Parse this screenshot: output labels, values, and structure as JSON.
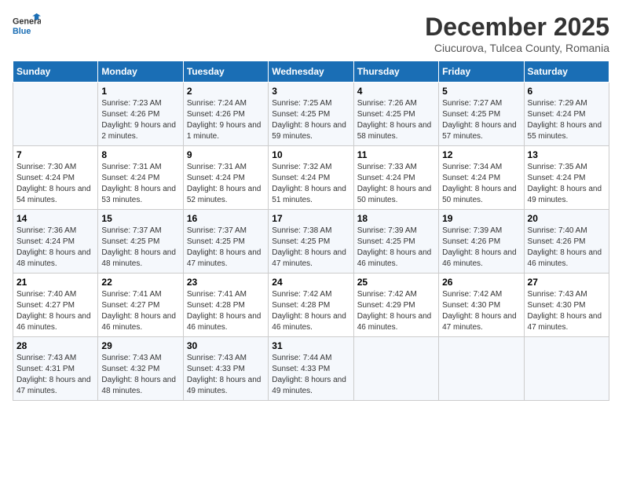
{
  "logo": {
    "line1": "General",
    "line2": "Blue"
  },
  "title": "December 2025",
  "subtitle": "Ciucurova, Tulcea County, Romania",
  "weekdays": [
    "Sunday",
    "Monday",
    "Tuesday",
    "Wednesday",
    "Thursday",
    "Friday",
    "Saturday"
  ],
  "weeks": [
    [
      {
        "day": "",
        "sunrise": "",
        "sunset": "",
        "daylight": ""
      },
      {
        "day": "1",
        "sunrise": "Sunrise: 7:23 AM",
        "sunset": "Sunset: 4:26 PM",
        "daylight": "Daylight: 9 hours and 2 minutes."
      },
      {
        "day": "2",
        "sunrise": "Sunrise: 7:24 AM",
        "sunset": "Sunset: 4:26 PM",
        "daylight": "Daylight: 9 hours and 1 minute."
      },
      {
        "day": "3",
        "sunrise": "Sunrise: 7:25 AM",
        "sunset": "Sunset: 4:25 PM",
        "daylight": "Daylight: 8 hours and 59 minutes."
      },
      {
        "day": "4",
        "sunrise": "Sunrise: 7:26 AM",
        "sunset": "Sunset: 4:25 PM",
        "daylight": "Daylight: 8 hours and 58 minutes."
      },
      {
        "day": "5",
        "sunrise": "Sunrise: 7:27 AM",
        "sunset": "Sunset: 4:25 PM",
        "daylight": "Daylight: 8 hours and 57 minutes."
      },
      {
        "day": "6",
        "sunrise": "Sunrise: 7:29 AM",
        "sunset": "Sunset: 4:24 PM",
        "daylight": "Daylight: 8 hours and 55 minutes."
      }
    ],
    [
      {
        "day": "7",
        "sunrise": "Sunrise: 7:30 AM",
        "sunset": "Sunset: 4:24 PM",
        "daylight": "Daylight: 8 hours and 54 minutes."
      },
      {
        "day": "8",
        "sunrise": "Sunrise: 7:31 AM",
        "sunset": "Sunset: 4:24 PM",
        "daylight": "Daylight: 8 hours and 53 minutes."
      },
      {
        "day": "9",
        "sunrise": "Sunrise: 7:31 AM",
        "sunset": "Sunset: 4:24 PM",
        "daylight": "Daylight: 8 hours and 52 minutes."
      },
      {
        "day": "10",
        "sunrise": "Sunrise: 7:32 AM",
        "sunset": "Sunset: 4:24 PM",
        "daylight": "Daylight: 8 hours and 51 minutes."
      },
      {
        "day": "11",
        "sunrise": "Sunrise: 7:33 AM",
        "sunset": "Sunset: 4:24 PM",
        "daylight": "Daylight: 8 hours and 50 minutes."
      },
      {
        "day": "12",
        "sunrise": "Sunrise: 7:34 AM",
        "sunset": "Sunset: 4:24 PM",
        "daylight": "Daylight: 8 hours and 50 minutes."
      },
      {
        "day": "13",
        "sunrise": "Sunrise: 7:35 AM",
        "sunset": "Sunset: 4:24 PM",
        "daylight": "Daylight: 8 hours and 49 minutes."
      }
    ],
    [
      {
        "day": "14",
        "sunrise": "Sunrise: 7:36 AM",
        "sunset": "Sunset: 4:24 PM",
        "daylight": "Daylight: 8 hours and 48 minutes."
      },
      {
        "day": "15",
        "sunrise": "Sunrise: 7:37 AM",
        "sunset": "Sunset: 4:25 PM",
        "daylight": "Daylight: 8 hours and 48 minutes."
      },
      {
        "day": "16",
        "sunrise": "Sunrise: 7:37 AM",
        "sunset": "Sunset: 4:25 PM",
        "daylight": "Daylight: 8 hours and 47 minutes."
      },
      {
        "day": "17",
        "sunrise": "Sunrise: 7:38 AM",
        "sunset": "Sunset: 4:25 PM",
        "daylight": "Daylight: 8 hours and 47 minutes."
      },
      {
        "day": "18",
        "sunrise": "Sunrise: 7:39 AM",
        "sunset": "Sunset: 4:25 PM",
        "daylight": "Daylight: 8 hours and 46 minutes."
      },
      {
        "day": "19",
        "sunrise": "Sunrise: 7:39 AM",
        "sunset": "Sunset: 4:26 PM",
        "daylight": "Daylight: 8 hours and 46 minutes."
      },
      {
        "day": "20",
        "sunrise": "Sunrise: 7:40 AM",
        "sunset": "Sunset: 4:26 PM",
        "daylight": "Daylight: 8 hours and 46 minutes."
      }
    ],
    [
      {
        "day": "21",
        "sunrise": "Sunrise: 7:40 AM",
        "sunset": "Sunset: 4:27 PM",
        "daylight": "Daylight: 8 hours and 46 minutes."
      },
      {
        "day": "22",
        "sunrise": "Sunrise: 7:41 AM",
        "sunset": "Sunset: 4:27 PM",
        "daylight": "Daylight: 8 hours and 46 minutes."
      },
      {
        "day": "23",
        "sunrise": "Sunrise: 7:41 AM",
        "sunset": "Sunset: 4:28 PM",
        "daylight": "Daylight: 8 hours and 46 minutes."
      },
      {
        "day": "24",
        "sunrise": "Sunrise: 7:42 AM",
        "sunset": "Sunset: 4:28 PM",
        "daylight": "Daylight: 8 hours and 46 minutes."
      },
      {
        "day": "25",
        "sunrise": "Sunrise: 7:42 AM",
        "sunset": "Sunset: 4:29 PM",
        "daylight": "Daylight: 8 hours and 46 minutes."
      },
      {
        "day": "26",
        "sunrise": "Sunrise: 7:42 AM",
        "sunset": "Sunset: 4:30 PM",
        "daylight": "Daylight: 8 hours and 47 minutes."
      },
      {
        "day": "27",
        "sunrise": "Sunrise: 7:43 AM",
        "sunset": "Sunset: 4:30 PM",
        "daylight": "Daylight: 8 hours and 47 minutes."
      }
    ],
    [
      {
        "day": "28",
        "sunrise": "Sunrise: 7:43 AM",
        "sunset": "Sunset: 4:31 PM",
        "daylight": "Daylight: 8 hours and 47 minutes."
      },
      {
        "day": "29",
        "sunrise": "Sunrise: 7:43 AM",
        "sunset": "Sunset: 4:32 PM",
        "daylight": "Daylight: 8 hours and 48 minutes."
      },
      {
        "day": "30",
        "sunrise": "Sunrise: 7:43 AM",
        "sunset": "Sunset: 4:33 PM",
        "daylight": "Daylight: 8 hours and 49 minutes."
      },
      {
        "day": "31",
        "sunrise": "Sunrise: 7:44 AM",
        "sunset": "Sunset: 4:33 PM",
        "daylight": "Daylight: 8 hours and 49 minutes."
      },
      {
        "day": "",
        "sunrise": "",
        "sunset": "",
        "daylight": ""
      },
      {
        "day": "",
        "sunrise": "",
        "sunset": "",
        "daylight": ""
      },
      {
        "day": "",
        "sunrise": "",
        "sunset": "",
        "daylight": ""
      }
    ]
  ]
}
